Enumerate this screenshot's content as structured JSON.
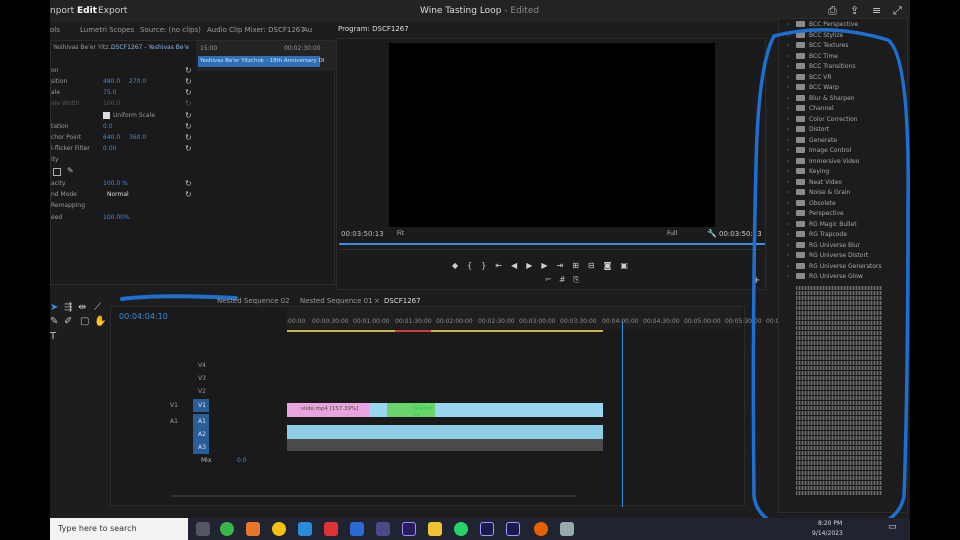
{
  "menu": {
    "items": [
      "nport",
      "Edit",
      "Export"
    ],
    "title": "Wine Tasting Loop",
    "title_suffix": "- Edited"
  },
  "source_tabs": [
    "ols",
    "Lumetri Scopes",
    "Source: (no clips)",
    "Audio Clip Mixer: DSCF1267",
    "Au"
  ],
  "effect_controls": {
    "clip_selector": "DSCF1267 - Yeshivas Be'e",
    "clip_selector_left": "Yeshivas Be'er Yitz...",
    "mini_time_start": "15:00",
    "mini_time_end": "00:02:30:00",
    "mini_clip": "Yeshivas Be'er Yitzchok - 18th Anniversary Di",
    "rows": [
      {
        "label": "on",
        "v1": "",
        "v2": ""
      },
      {
        "label": "sition",
        "v1": "480.0",
        "v2": "270.0"
      },
      {
        "label": "ale",
        "v1": "75.0",
        "v2": ""
      },
      {
        "label": "ale Width",
        "v1": "100.0",
        "v2": ""
      },
      {
        "label": "",
        "v1": "Uniform Scale",
        "v2": ""
      },
      {
        "label": "tation",
        "v1": "0.0",
        "v2": ""
      },
      {
        "label": "chor Point",
        "v1": "640.0",
        "v2": "360.0"
      },
      {
        "label": "i-flicker Filter",
        "v1": "0.00",
        "v2": ""
      },
      {
        "label": "ity",
        "v1": "",
        "v2": ""
      },
      {
        "label": "",
        "v1": "",
        "v2": ""
      },
      {
        "label": "acity",
        "v1": "100.0 %",
        "v2": ""
      },
      {
        "label": "nd Mode",
        "v1": "Normal",
        "v2": ""
      },
      {
        "label": "Remapping",
        "v1": "",
        "v2": ""
      },
      {
        "label": "eed",
        "v1": "100.00%",
        "v2": ""
      }
    ]
  },
  "program": {
    "title": "Program: DSCF1267",
    "timecode_left": "00:03:50:13",
    "fit": "Fit",
    "quality": "Full",
    "timecode_right": "00:03:50:13"
  },
  "timeline": {
    "tabs": [
      "Nested Sequence 02",
      "Nested Sequence 01",
      "DSCF1267"
    ],
    "playhead": "00:04:04:10",
    "ruler": [
      ":00:00",
      "00:00:30:00",
      "00:01:00:00",
      "00:01:30:00",
      "00:02:00:00",
      "00:02:30:00",
      "00:03:00:00",
      "00:03:30:00",
      "00:04:00:00",
      "00:04:30:00",
      "00:05:00:00",
      "00:05:30:00",
      "00:0"
    ],
    "video_tracks": [
      "V3",
      "V2",
      "V1"
    ],
    "top_track": "V4",
    "audio_tracks": [
      "A1",
      "A2",
      "A3"
    ],
    "mix_label": "Mix",
    "mix_value": "0.0",
    "clip_label": "slide.mp4 [157.39%]",
    "nested_label": "Nested Se",
    "v1_label": "V1",
    "a1_label": "A1"
  },
  "effects": [
    "BCC Perspective",
    "BCC Stylize",
    "BCC Textures",
    "BCC Time",
    "BCC Transitions",
    "BCC VR",
    "BCC Warp",
    "Blur & Sharpen",
    "Channel",
    "Color Correction",
    "Distort",
    "Generate",
    "Image Control",
    "Immersive Video",
    "Keying",
    "Neat Video",
    "Noise & Grain",
    "Obsolete",
    "Perspective",
    "RG Magic Bullet",
    "RG Trapcode",
    "RG Universe Blur",
    "RG Universe Distort",
    "RG Universe Generators",
    "RG Universe Glow"
  ],
  "taskbar": {
    "search_placeholder": "Type here to search",
    "time": "8:20 PM",
    "date": "9/14/2023"
  },
  "colors": {
    "accent": "#3b8ddf",
    "annotation": "#1d6fd1",
    "clip_pink": "#e8a3e0",
    "clip_cyan": "#9ad6ef",
    "clip_green": "#6bd36b"
  }
}
